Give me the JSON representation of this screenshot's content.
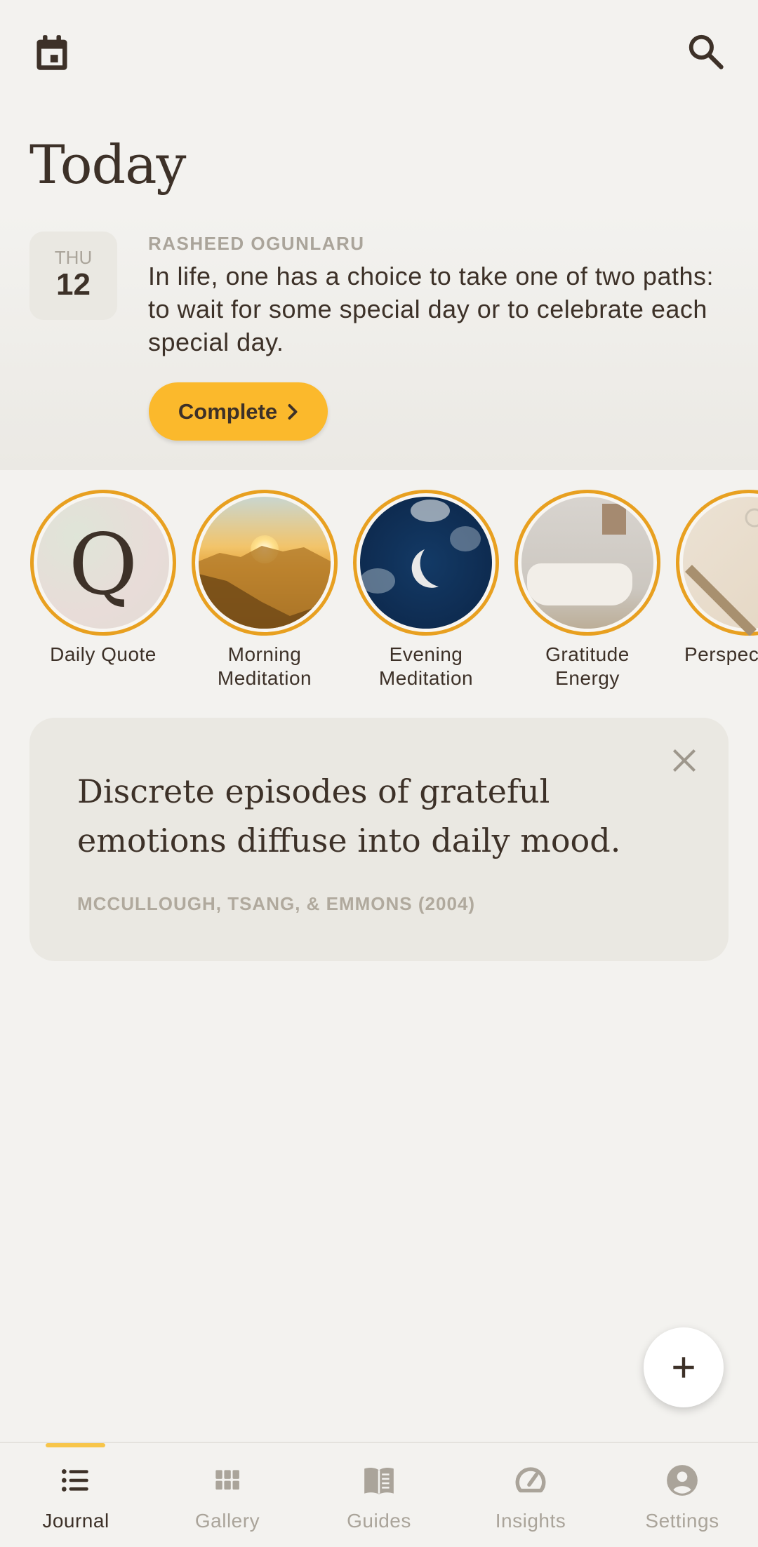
{
  "header": {
    "title": "Today",
    "calendar_icon": "calendar-icon",
    "search_icon": "search-icon"
  },
  "entry": {
    "day_of_week": "THU",
    "day_number": "12",
    "author": "RASHEED OGUNLARU",
    "quote": "In life, one has a choice to take one of two paths: to wait for some special day or to celebrate each special day.",
    "complete_label": "Complete"
  },
  "stories": [
    {
      "label": "Daily Quote",
      "glyph": "Q"
    },
    {
      "label": "Morning Meditation"
    },
    {
      "label": "Evening Meditation"
    },
    {
      "label": "Gratitude Energy"
    },
    {
      "label": "Perspec"
    }
  ],
  "insight_card": {
    "text": "Discrete episodes of grateful emotions diffuse into daily mood.",
    "citation": "MCCULLOUGH, TSANG, & EMMONS (2004)"
  },
  "nav": [
    {
      "label": "Journal",
      "icon": "list-icon",
      "active": true
    },
    {
      "label": "Gallery",
      "icon": "grid-icon"
    },
    {
      "label": "Guides",
      "icon": "book-icon"
    },
    {
      "label": "Insights",
      "icon": "gauge-icon"
    },
    {
      "label": "Settings",
      "icon": "account-icon"
    }
  ],
  "colors": {
    "accent": "#fbb92c",
    "ring": "#e8a020",
    "text": "#3d3128",
    "muted": "#aaa49a",
    "background": "#f3f2ef"
  }
}
